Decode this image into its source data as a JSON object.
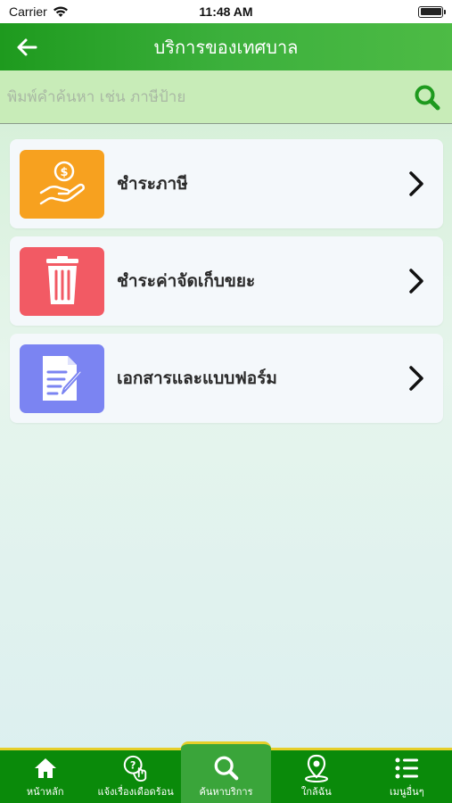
{
  "status_bar": {
    "carrier": "Carrier",
    "time": "11:48 AM"
  },
  "header": {
    "title": "บริการของเทศบาล"
  },
  "search": {
    "placeholder": "พิมพ์คำค้นหา เช่น ภาษีป้าย"
  },
  "services": [
    {
      "label": "ชำระภาษี",
      "icon": "hand-money-icon",
      "color": "#f7a11f"
    },
    {
      "label": "ชำระค่าจัดเก็บขยะ",
      "icon": "trash-bin-icon",
      "color": "#f25a64"
    },
    {
      "label": "เอกสารและแบบฟอร์ม",
      "icon": "document-edit-icon",
      "color": "#7b84f2"
    }
  ],
  "tabs": [
    {
      "label": "หน้าหลัก",
      "icon": "home-icon",
      "active": false
    },
    {
      "label": "แจ้งเรื่องเดือดร้อน",
      "icon": "help-touch-icon",
      "active": false
    },
    {
      "label": "ค้นหาบริการ",
      "icon": "search-icon",
      "active": true
    },
    {
      "label": "ใกล้ฉัน",
      "icon": "location-pin-icon",
      "active": false
    },
    {
      "label": "เมนูอื่นๆ",
      "icon": "menu-list-icon",
      "active": false
    }
  ],
  "colors": {
    "header_green": "#2ea72e",
    "tab_green": "#0a8a0a",
    "search_icon_green": "#1e9a1e",
    "tab_accent": "#e6cf2a"
  }
}
